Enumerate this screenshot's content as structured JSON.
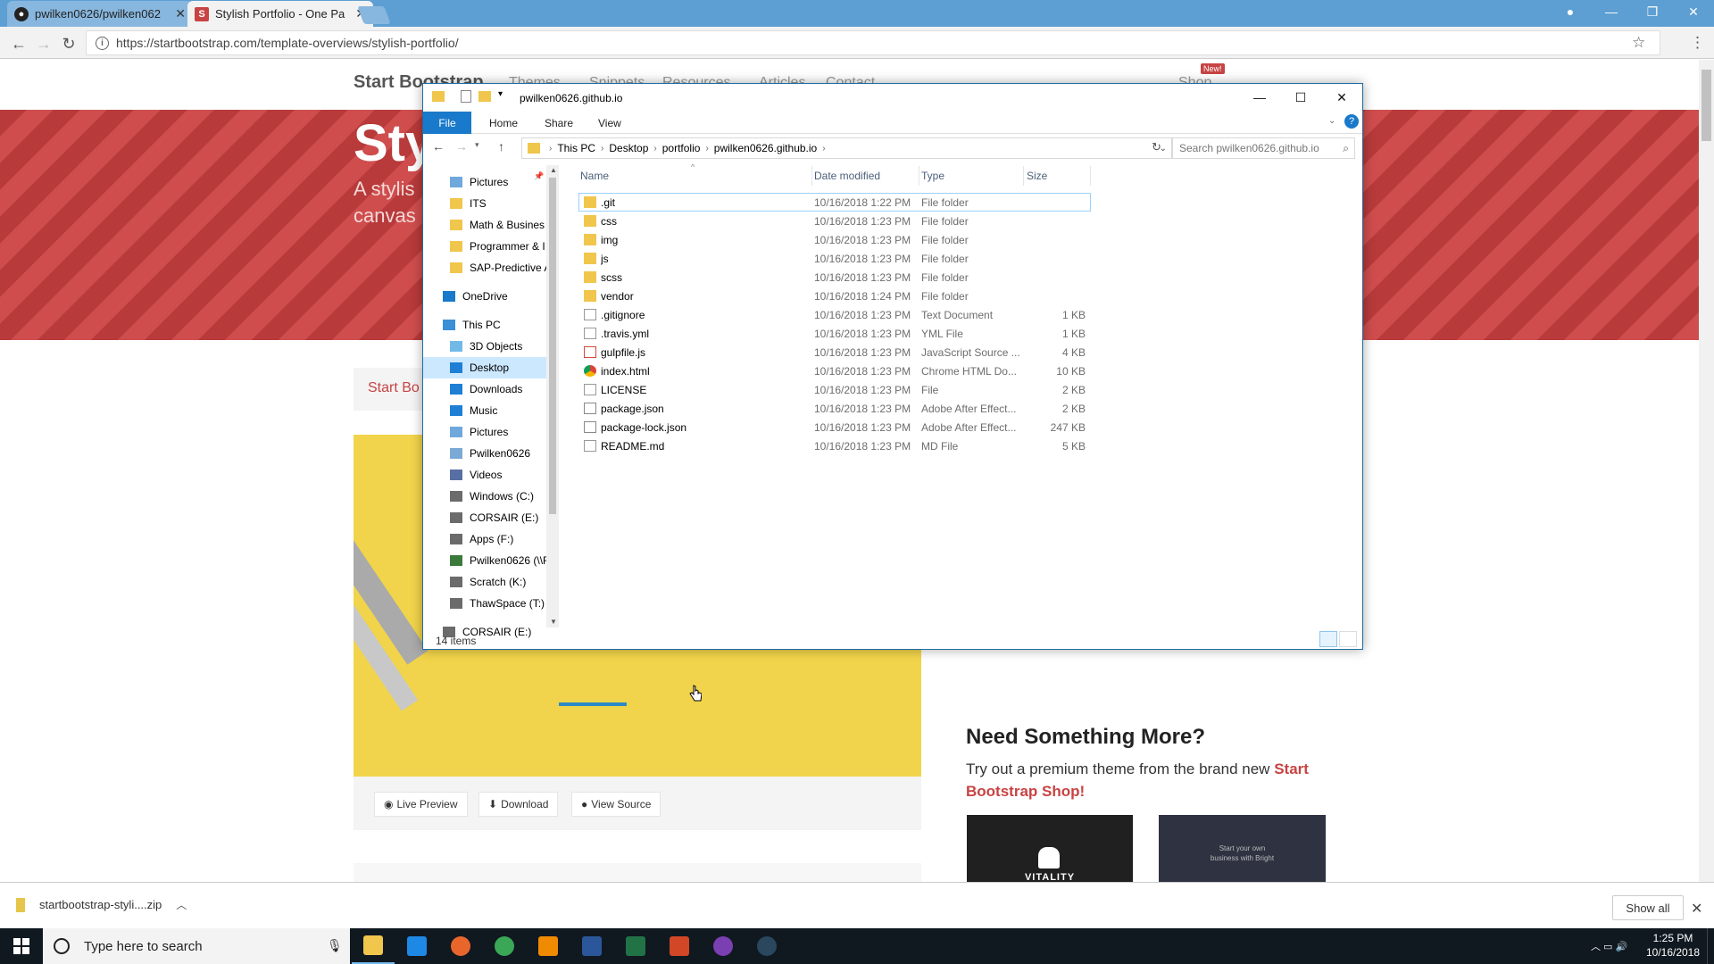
{
  "browser": {
    "tabs": [
      {
        "label": "pwilken0626/pwilken062",
        "icon": "github-icon"
      },
      {
        "label": "Stylish Portfolio - One Pa",
        "icon": "startbootstrap-icon"
      }
    ],
    "url": "https://startbootstrap.com/template-overviews/stylish-portfolio/"
  },
  "site": {
    "brand": "Start Bootstrap",
    "nav": [
      "Themes",
      "Snippets",
      "Resources",
      "Articles",
      "Contact"
    ],
    "shop": "Shop",
    "new_badge": "New!",
    "hero_title": "Sty",
    "hero_sub_1": "A stylis",
    "hero_sub_2": "canvas",
    "crumb": "Start Bo",
    "buttons": {
      "live": "Live Preview",
      "download": "Download",
      "source": "View Source"
    },
    "need_title": "Need Something More?",
    "need_text": "Try out a premium theme from the brand new ",
    "need_link": "Start Bootstrap Shop!",
    "thumb1": "VITALITY",
    "thumb2_1": "Start your own",
    "thumb2_2": "business with Bright"
  },
  "explorer": {
    "title": "pwilken0626.github.io",
    "ribbon": [
      "File",
      "Home",
      "Share",
      "View"
    ],
    "breadcrumb": [
      "This PC",
      "Desktop",
      "portfolio",
      "pwilken0626.github.io"
    ],
    "search_placeholder": "Search pwilken0626.github.io",
    "columns": {
      "name": "Name",
      "date": "Date modified",
      "type": "Type",
      "size": "Size"
    },
    "nav_items": [
      {
        "label": "Pictures",
        "icon": "pictures-icon"
      },
      {
        "label": "ITS",
        "icon": "folder-icon"
      },
      {
        "label": "Math & Busines",
        "icon": "folder-icon"
      },
      {
        "label": "Programmer & I",
        "icon": "folder-icon"
      },
      {
        "label": "SAP-Predictive A",
        "icon": "folder-icon"
      },
      {
        "label": "OneDrive",
        "icon": "onedrive-icon"
      },
      {
        "label": "This PC",
        "icon": "pc-icon"
      },
      {
        "label": "3D Objects",
        "icon": "3d-objects-icon"
      },
      {
        "label": "Desktop",
        "icon": "desktop-icon"
      },
      {
        "label": "Downloads",
        "icon": "downloads-icon"
      },
      {
        "label": "Music",
        "icon": "music-icon"
      },
      {
        "label": "Pictures",
        "icon": "pictures-icon"
      },
      {
        "label": "Pwilken0626",
        "icon": "user-folder-icon"
      },
      {
        "label": "Videos",
        "icon": "videos-icon"
      },
      {
        "label": "Windows (C:)",
        "icon": "drive-icon"
      },
      {
        "label": "CORSAIR (E:)",
        "icon": "drive-icon"
      },
      {
        "label": "Apps (F:)",
        "icon": "drive-icon"
      },
      {
        "label": "Pwilken0626 (\\\\F",
        "icon": "network-drive-icon"
      },
      {
        "label": "Scratch (K:)",
        "icon": "drive-icon"
      },
      {
        "label": "ThawSpace (T:)",
        "icon": "drive-icon"
      },
      {
        "label": "CORSAIR (E:)",
        "icon": "drive-icon"
      }
    ],
    "files": [
      {
        "name": ".git",
        "date": "10/16/2018 1:22 PM",
        "type": "File folder",
        "size": "",
        "icon": "folder-icon"
      },
      {
        "name": "css",
        "date": "10/16/2018 1:23 PM",
        "type": "File folder",
        "size": "",
        "icon": "folder-icon"
      },
      {
        "name": "img",
        "date": "10/16/2018 1:23 PM",
        "type": "File folder",
        "size": "",
        "icon": "folder-icon"
      },
      {
        "name": "js",
        "date": "10/16/2018 1:23 PM",
        "type": "File folder",
        "size": "",
        "icon": "folder-icon"
      },
      {
        "name": "scss",
        "date": "10/16/2018 1:23 PM",
        "type": "File folder",
        "size": "",
        "icon": "folder-icon"
      },
      {
        "name": "vendor",
        "date": "10/16/2018 1:24 PM",
        "type": "File folder",
        "size": "",
        "icon": "folder-icon"
      },
      {
        "name": ".gitignore",
        "date": "10/16/2018 1:23 PM",
        "type": "Text Document",
        "size": "1 KB",
        "icon": "text-file-icon"
      },
      {
        "name": ".travis.yml",
        "date": "10/16/2018 1:23 PM",
        "type": "YML File",
        "size": "1 KB",
        "icon": "file-icon"
      },
      {
        "name": "gulpfile.js",
        "date": "10/16/2018 1:23 PM",
        "type": "JavaScript Source ...",
        "size": "4 KB",
        "icon": "js-file-icon"
      },
      {
        "name": "index.html",
        "date": "10/16/2018 1:23 PM",
        "type": "Chrome HTML Do...",
        "size": "10 KB",
        "icon": "chrome-html-icon"
      },
      {
        "name": "LICENSE",
        "date": "10/16/2018 1:23 PM",
        "type": "File",
        "size": "2 KB",
        "icon": "file-icon"
      },
      {
        "name": "package.json",
        "date": "10/16/2018 1:23 PM",
        "type": "Adobe After Effect...",
        "size": "2 KB",
        "icon": "json-file-icon"
      },
      {
        "name": "package-lock.json",
        "date": "10/16/2018 1:23 PM",
        "type": "Adobe After Effect...",
        "size": "247 KB",
        "icon": "json-file-icon"
      },
      {
        "name": "README.md",
        "date": "10/16/2018 1:23 PM",
        "type": "MD File",
        "size": "5 KB",
        "icon": "file-icon"
      }
    ],
    "status": "14 items"
  },
  "download_shelf": {
    "file": "startbootstrap-styli....zip",
    "show_all": "Show all"
  },
  "taskbar": {
    "search": "Type here to search",
    "time": "1:25 PM",
    "date": "10/16/2018",
    "apps": [
      "file-explorer-icon",
      "edge-icon",
      "firefox-icon",
      "chrome-icon",
      "vlc-icon",
      "word-icon",
      "excel-icon",
      "powerpoint-icon",
      "onenote-icon",
      "steam-icon"
    ]
  },
  "colors": {
    "accent": "#1979ca",
    "hero": "#c84343",
    "folder": "#f0c64c",
    "taskbar": "#101820"
  }
}
